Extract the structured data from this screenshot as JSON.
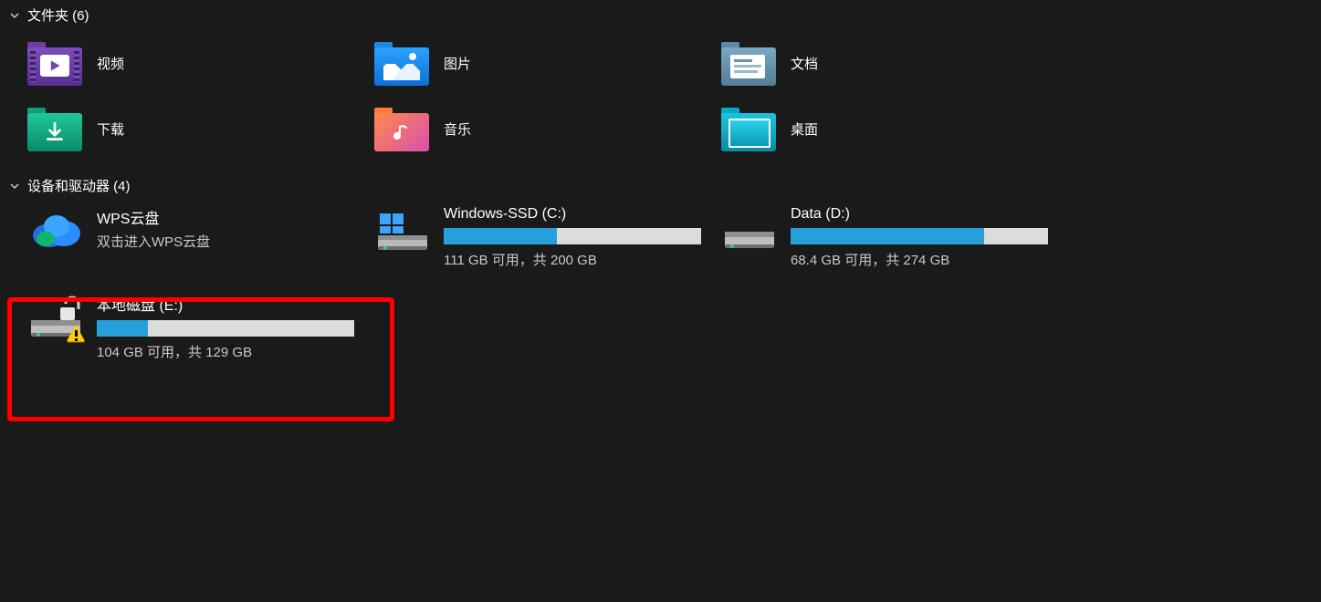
{
  "sections": {
    "folders": {
      "title": "文件夹 (6)"
    },
    "drives": {
      "title": "设备和驱动器 (4)"
    }
  },
  "folders": [
    {
      "label": "视频",
      "icon": "videos"
    },
    {
      "label": "图片",
      "icon": "pictures"
    },
    {
      "label": "文档",
      "icon": "documents"
    },
    {
      "label": "下载",
      "icon": "downloads"
    },
    {
      "label": "音乐",
      "icon": "music"
    },
    {
      "label": "桌面",
      "icon": "desktop"
    }
  ],
  "drives": {
    "wps": {
      "name": "WPS云盘",
      "sub": "双击进入WPS云盘"
    },
    "c": {
      "name": "Windows-SSD (C:)",
      "status": "111 GB 可用，共 200 GB",
      "fill_pct": 44
    },
    "d": {
      "name": "Data (D:)",
      "status": "68.4 GB 可用，共 274 GB",
      "fill_pct": 75
    },
    "e": {
      "name": "本地磁盘 (E:)",
      "status": "104 GB 可用，共 129 GB",
      "fill_pct": 20
    }
  }
}
